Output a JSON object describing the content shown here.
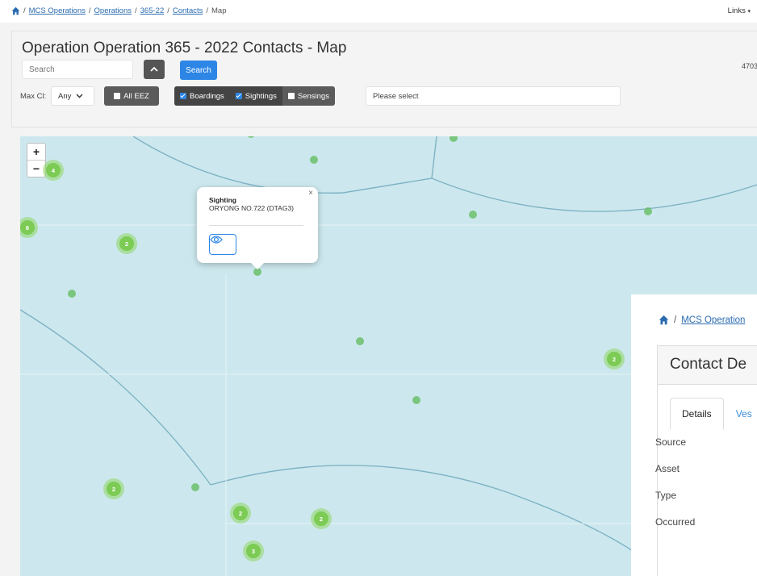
{
  "breadcrumb": {
    "items": [
      "MCS Operations",
      "Operations",
      "365-22",
      "Contacts"
    ],
    "current": "Map",
    "links_label": "Links"
  },
  "header": {
    "title": "Operation Operation 365 - 2022 Contacts - Map",
    "search_placeholder": "Search",
    "search_button": "Search",
    "count": "4703",
    "maxcl_label": "Max Cl:",
    "maxcl_value": "Any",
    "eez_label": "All EEZ",
    "toggles": [
      {
        "label": "Boardings",
        "checked": true
      },
      {
        "label": "Sightings",
        "checked": true
      },
      {
        "label": "Sensings",
        "checked": false
      }
    ],
    "select_placeholder": "Please select"
  },
  "map": {
    "zoom_in": "+",
    "zoom_out": "−",
    "clusters": [
      "4",
      "6",
      "2",
      "2",
      "2",
      "2",
      "2",
      "3"
    ],
    "popup": {
      "title": "Sighting",
      "name": "ORYONG NO.722 (DTAG3)",
      "close": "×"
    }
  },
  "detail": {
    "breadcrumb_item": "MCS Operation",
    "title": "Contact De",
    "tabs": [
      "Details",
      "Ves"
    ],
    "fields": [
      "Source",
      "Asset",
      "Type",
      "Occurred"
    ]
  },
  "colors": {
    "map_bg": "#cce8ee",
    "point": "#6bbf6b",
    "cluster": "#7ccb54",
    "primary": "#2d86e6"
  }
}
